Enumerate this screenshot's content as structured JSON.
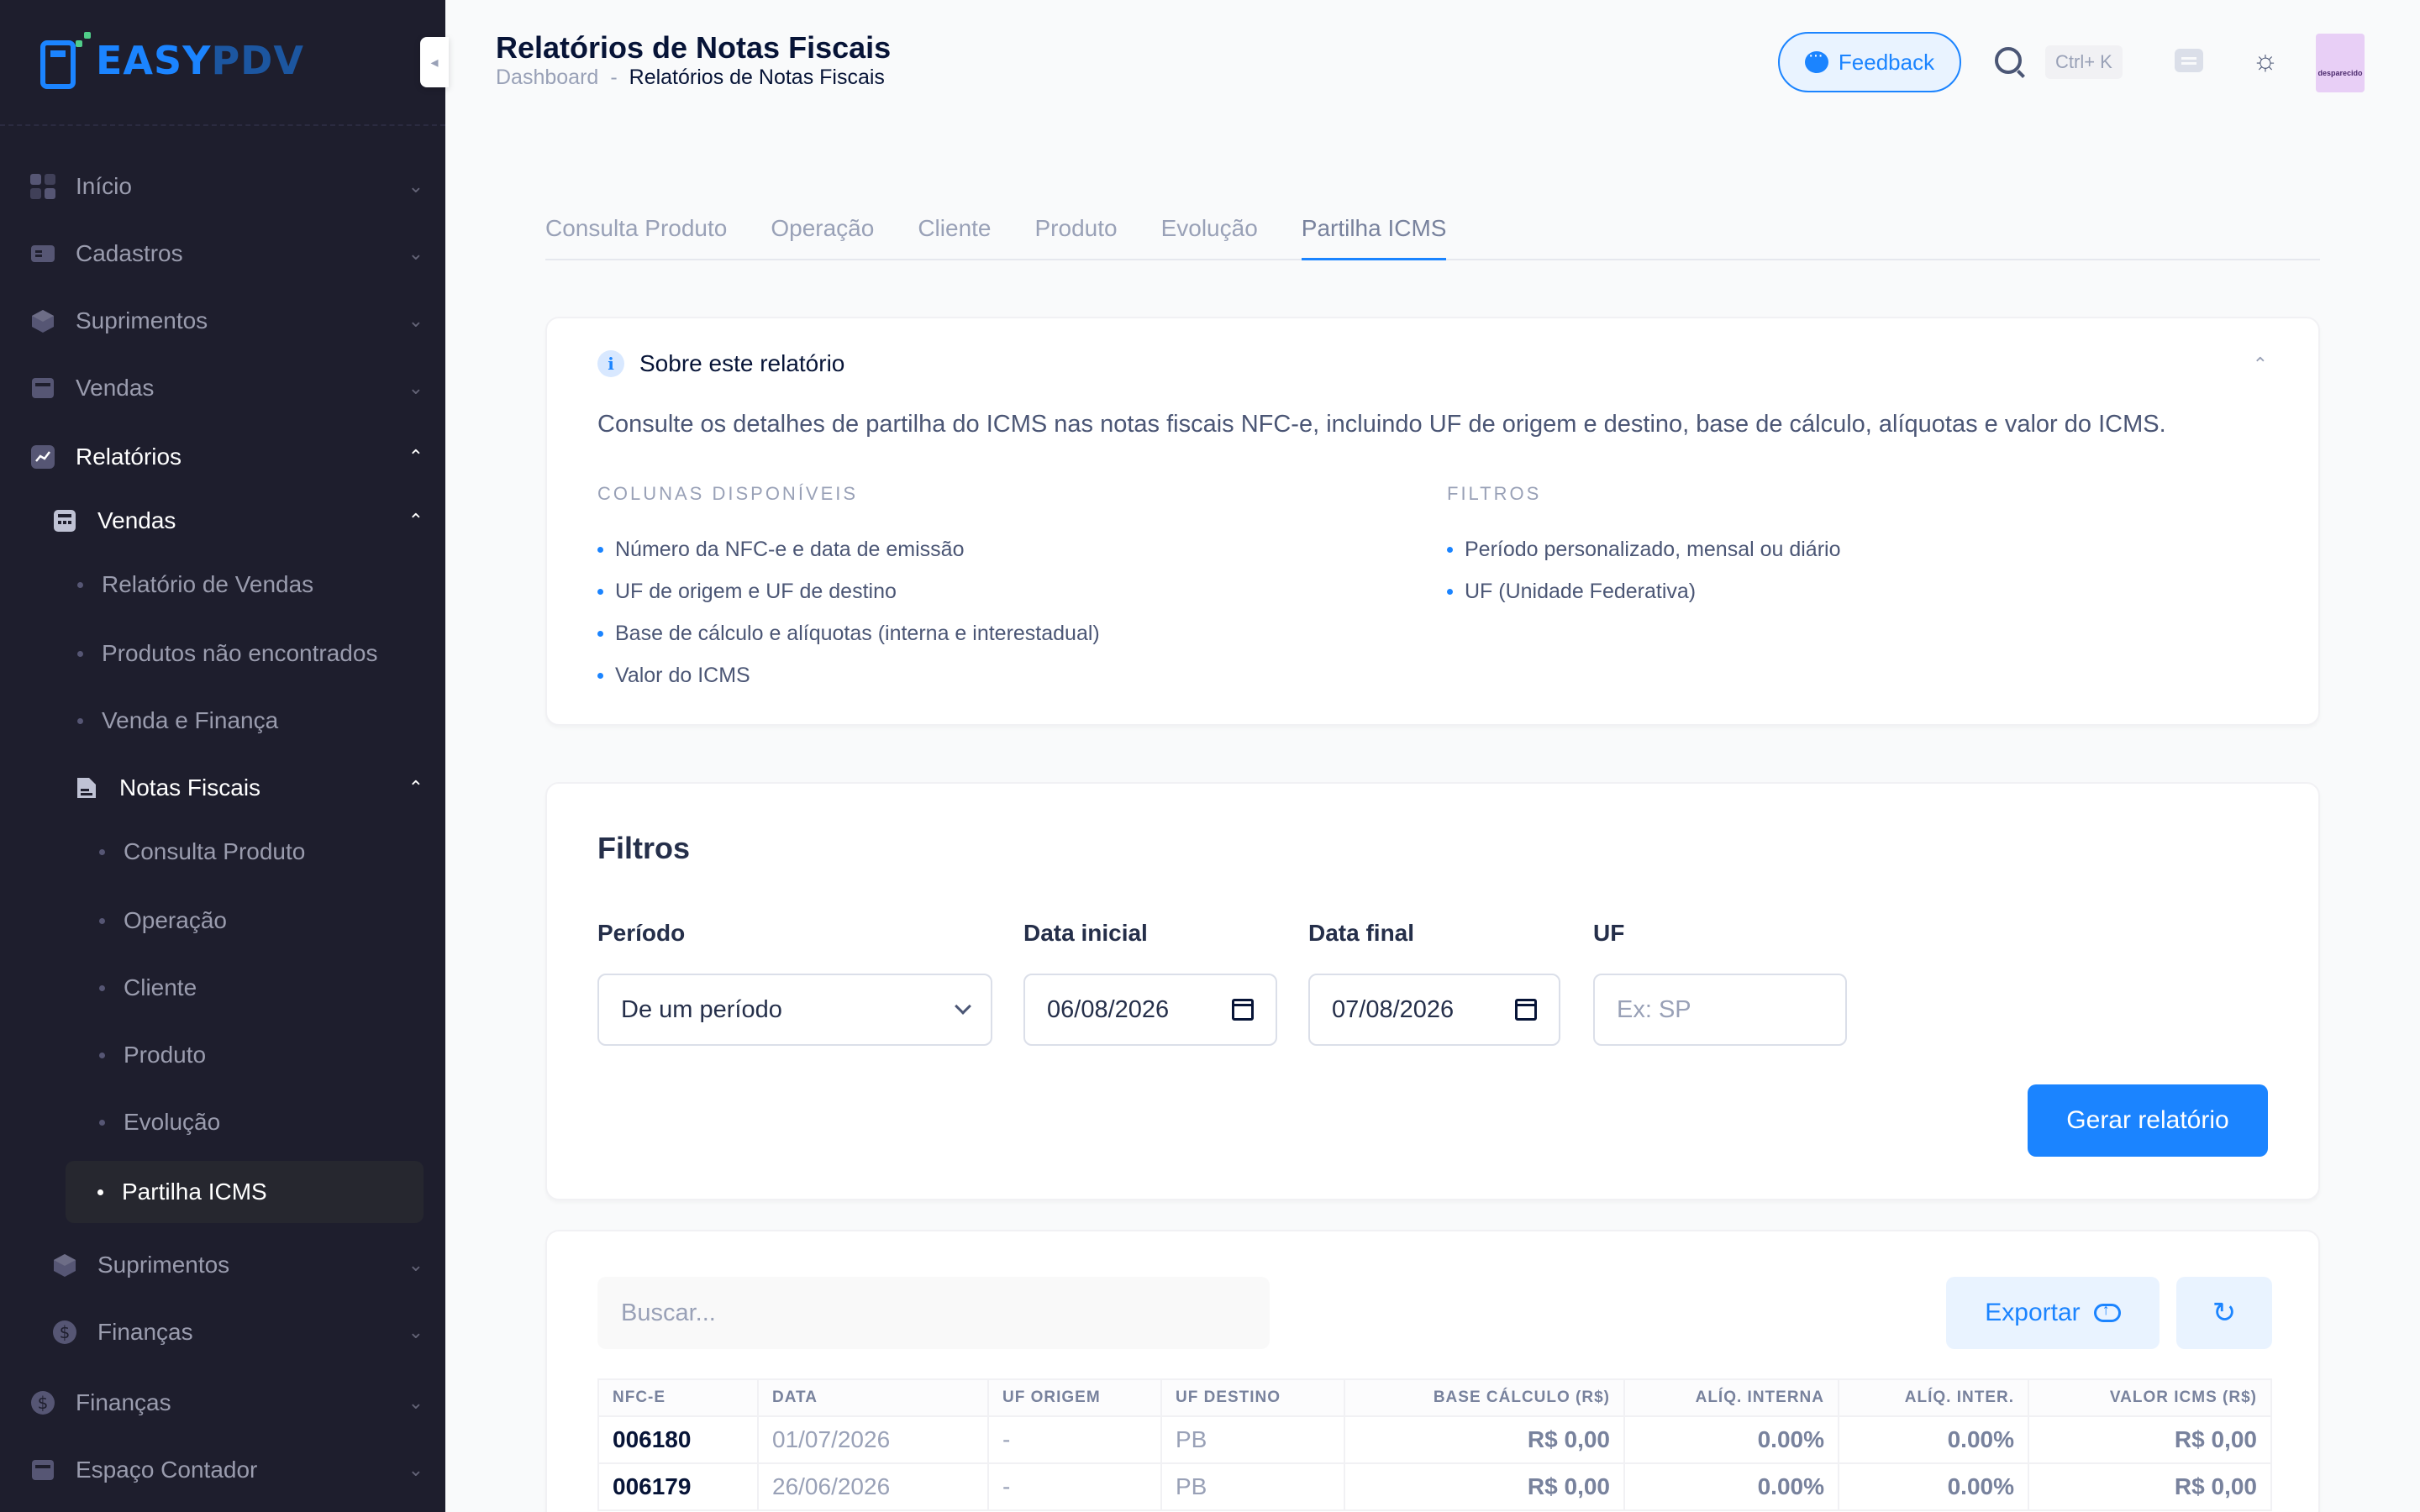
{
  "app": {
    "logo_left": "EASY",
    "logo_right": "PDV"
  },
  "sidebar": {
    "items": [
      {
        "label": "Início",
        "icon": "grid-icon"
      },
      {
        "label": "Cadastros",
        "icon": "id-card-icon"
      },
      {
        "label": "Suprimentos",
        "icon": "cube-icon"
      },
      {
        "label": "Vendas",
        "icon": "register-icon"
      },
      {
        "label": "Relatórios",
        "icon": "chart-line-icon"
      },
      {
        "label": "Vendas",
        "icon": "calculator-icon"
      },
      {
        "label": "Relatório de Vendas"
      },
      {
        "label": "Produtos não encontrados"
      },
      {
        "label": "Venda e Finança"
      },
      {
        "label": "Notas Fiscais",
        "icon": "document-icon"
      },
      {
        "label": "Consulta Produto"
      },
      {
        "label": "Operação"
      },
      {
        "label": "Cliente"
      },
      {
        "label": "Produto"
      },
      {
        "label": "Evolução"
      },
      {
        "label": "Partilha ICMS"
      },
      {
        "label": "Suprimentos",
        "icon": "cube-icon"
      },
      {
        "label": "Finanças",
        "icon": "dollar-icon"
      },
      {
        "label": "Finanças",
        "icon": "dollar-icon"
      },
      {
        "label": "Espaço Contador",
        "icon": "register-icon"
      }
    ]
  },
  "header": {
    "title": "Relatórios de Notas Fiscais",
    "breadcrumb": [
      "Dashboard",
      "-",
      "Relatórios de Notas Fiscais"
    ],
    "feedback_label": "Feedback",
    "shortcut": "Ctrl+ K",
    "avatar_text": "desparecido"
  },
  "tabs": [
    "Consulta Produto",
    "Operação",
    "Cliente",
    "Produto",
    "Evolução",
    "Partilha ICMS"
  ],
  "about": {
    "title": "Sobre este relatório",
    "description": "Consulte os detalhes de partilha do ICMS nas notas fiscais NFC-e, incluindo UF de origem e destino, base de cálculo, alíquotas e valor do ICMS.",
    "columns_title": "COLUNAS DISPONÍVEIS",
    "columns": [
      "Número da NFC-e e data de emissão",
      "UF de origem e UF de destino",
      "Base de cálculo e alíquotas (interna e interestadual)",
      "Valor do ICMS"
    ],
    "filters_title": "FILTROS",
    "filters": [
      "Período personalizado, mensal ou diário",
      "UF (Unidade Federativa)"
    ]
  },
  "filters": {
    "title": "Filtros",
    "periodo_label": "Período",
    "periodo_value": "De um período",
    "data_inicial_label": "Data inicial",
    "data_inicial_value": "06/08/2026",
    "data_final_label": "Data final",
    "data_final_value": "07/08/2026",
    "uf_label": "UF",
    "uf_placeholder": "Ex: SP",
    "submit_label": "Gerar relatório"
  },
  "results": {
    "search_placeholder": "Buscar...",
    "export_label": "Exportar",
    "columns": [
      "NFC-E",
      "DATA",
      "UF ORIGEM",
      "UF DESTINO",
      "BASE CÁLCULO (R$)",
      "ALÍQ. INTERNA",
      "ALÍQ. INTER.",
      "VALOR ICMS (R$)"
    ],
    "rows": [
      [
        "006180",
        "01/07/2026",
        "-",
        "PB",
        "R$ 0,00",
        "0.00%",
        "0.00%",
        "R$ 0,00"
      ],
      [
        "006179",
        "26/06/2026",
        "-",
        "PB",
        "R$ 0,00",
        "0.00%",
        "0.00%",
        "R$ 0,00"
      ]
    ]
  },
  "colors": {
    "primary": "#1b84ff",
    "sidebar_bg": "#1e1e2d",
    "page_bg": "#f9fafb"
  }
}
